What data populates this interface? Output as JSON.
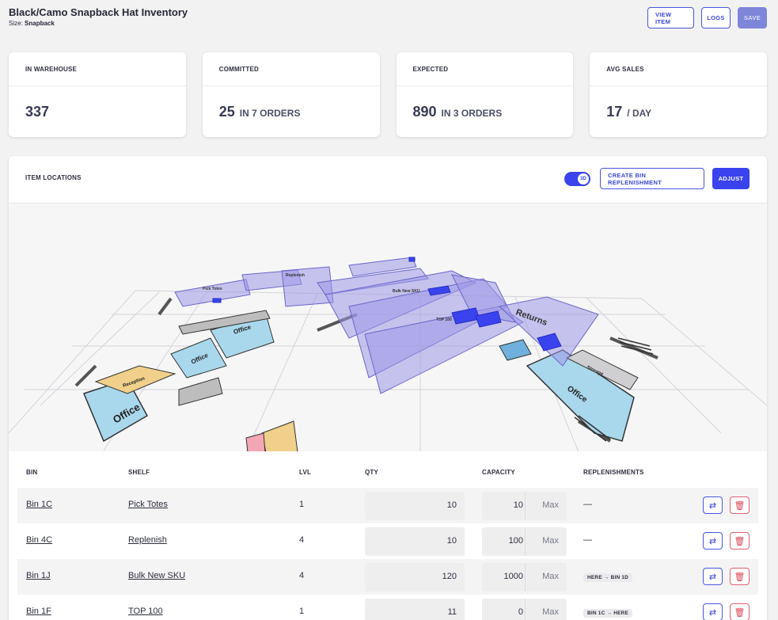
{
  "header": {
    "title": "Black/Camo Snapback Hat Inventory",
    "subtitle_key": "Size:",
    "subtitle_value": "Snapback",
    "view_item_label": "VIEW ITEM",
    "logs_label": "LOGS",
    "save_label": "SAVE"
  },
  "stats": [
    {
      "label": "IN WAREHOUSE",
      "value": "337",
      "suffix": ""
    },
    {
      "label": "COMMITTED",
      "value": "25",
      "suffix": "IN 7 ORDERS"
    },
    {
      "label": "EXPECTED",
      "value": "890",
      "suffix": "IN 3 ORDERS"
    },
    {
      "label": "AVG SALES",
      "value": "17",
      "suffix": "/ DAY"
    }
  ],
  "locations": {
    "title": "ITEM LOCATIONS",
    "toggle_label": "3D",
    "toggle_on": true,
    "create_replenishment_label": "CREATE BIN REPLENISHMENT",
    "adjust_label": "ADJUST"
  },
  "map": {
    "labels": {
      "returns": "Returns",
      "office_big": "Office",
      "office_right": "Office",
      "office_a": "Office",
      "office_b": "Office",
      "reception": "Reception",
      "storage": "Storage",
      "pick_totes": "Pick Totes",
      "replenish": "Replenish",
      "bulk": "Bulk New SKU",
      "top100": "TOP 100"
    },
    "colors": {
      "rack": "#9c98e6",
      "highlight": "#3a43ee",
      "office": "#a9d8ec",
      "reception": "#f0d08a",
      "floor_line": "#d8d8dc"
    }
  },
  "table": {
    "columns": [
      "BIN",
      "SHELF",
      "LVL",
      "QTY",
      "CAPACITY",
      "REPLENISHMENTS"
    ],
    "max_placeholder": "Max",
    "rows": [
      {
        "bin": "Bin 1C",
        "shelf": "Pick Totes",
        "lvl": "1",
        "qty": "10",
        "capacity": "10",
        "replenishment": "—",
        "badge": false
      },
      {
        "bin": "Bin 4C",
        "shelf": "Replenish",
        "lvl": "4",
        "qty": "10",
        "capacity": "100",
        "replenishment": "—",
        "badge": false
      },
      {
        "bin": "Bin 1J",
        "shelf": "Bulk New SKU",
        "lvl": "4",
        "qty": "120",
        "capacity": "1000",
        "replenishment": "HERE → BIN 1D",
        "badge": true
      },
      {
        "bin": "Bin 1F",
        "shelf": "TOP 100",
        "lvl": "1",
        "qty": "11",
        "capacity": "0",
        "replenishment": "BIN 1C → HERE",
        "badge": true
      }
    ]
  }
}
